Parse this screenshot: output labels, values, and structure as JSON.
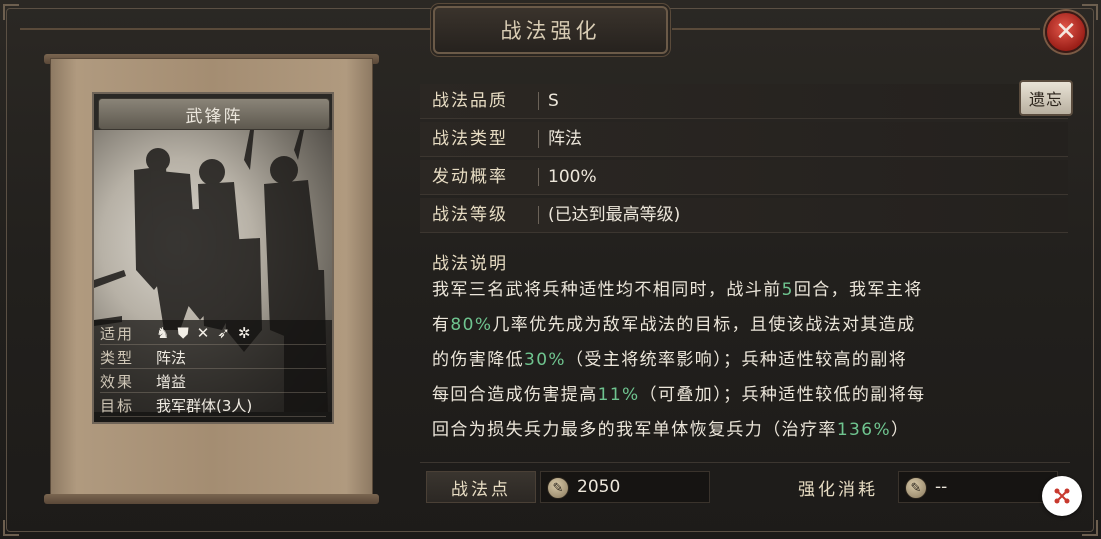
{
  "window": {
    "title": "战法强化",
    "close_symbol": "✕"
  },
  "card": {
    "name": "武锋阵",
    "info": [
      {
        "key": "适用",
        "value": ""
      },
      {
        "key": "类型",
        "value": "阵法"
      },
      {
        "key": "效果",
        "value": "增益"
      },
      {
        "key": "目标",
        "value": "我军群体(3人)"
      }
    ],
    "troop_icons": [
      "cavalry-icon",
      "shield-icon",
      "bow-icon",
      "spear-icon",
      "wheel-icon"
    ]
  },
  "details": [
    {
      "label": "战法品质",
      "value": "S"
    },
    {
      "label": "战法类型",
      "value": "阵法"
    },
    {
      "label": "发动概率",
      "value": "100%"
    },
    {
      "label": "战法等级",
      "value": "(已达到最高等级)"
    }
  ],
  "forget_button": "遗忘",
  "description": {
    "title": "战法说明",
    "lines": [
      [
        {
          "t": "我军三名武将兵种适性均不相同时，战斗前"
        },
        {
          "t": "5",
          "g": true
        },
        {
          "t": "回合，我军主将"
        }
      ],
      [
        {
          "t": "有"
        },
        {
          "t": "80%",
          "g": true
        },
        {
          "t": "几率优先成为敌军战法的目标，且使该战法对其造成"
        }
      ],
      [
        {
          "t": "的伤害降低"
        },
        {
          "t": "30%",
          "g": true
        },
        {
          "t": "（受主将统率影响）；兵种适性较高的副将"
        }
      ],
      [
        {
          "t": "每回合造成伤害提高"
        },
        {
          "t": "11%",
          "g": true
        },
        {
          "t": "（可叠加）；兵种适性较低的副将每"
        }
      ],
      [
        {
          "t": "回合为损失兵力最多的我军单体恢复兵力（治疗率"
        },
        {
          "t": "136%",
          "g": true
        },
        {
          "t": "）"
        }
      ]
    ]
  },
  "footer": {
    "points_label": "战法点",
    "points_value": "2050",
    "cost_label": "强化消耗",
    "cost_value": "--"
  },
  "colors": {
    "highlight": "#6fc48f",
    "close_red": "#c8392e"
  }
}
